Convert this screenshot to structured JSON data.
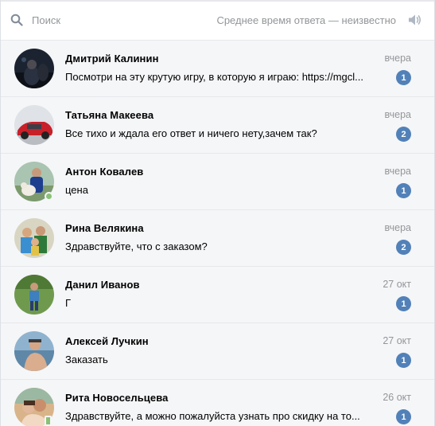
{
  "header": {
    "search_placeholder": "Поиск",
    "response_time": "Среднее время ответа — неизвестно"
  },
  "icons": {
    "search": "search-icon",
    "sound": "speaker-icon"
  },
  "colors": {
    "accent": "#5181b8",
    "online": "#8ac176",
    "muted_text": "#939699",
    "background": "#f5f6f8"
  },
  "conversations": [
    {
      "name": "Дмитрий Калинин",
      "date": "вчера",
      "message": "Посмотри на эту крутую игру, в которую я играю: https://mgcl...",
      "unread": "1",
      "status": "none"
    },
    {
      "name": "Татьяна Макеева",
      "date": "вчера",
      "message": "Все тихо и ждала его ответ и ничего нету,зачем так?",
      "unread": "2",
      "status": "none"
    },
    {
      "name": "Антон Ковалев",
      "date": "вчера",
      "message": "цена",
      "unread": "1",
      "status": "online"
    },
    {
      "name": "Рина Велякина",
      "date": "вчера",
      "message": "Здравствуйте, что с заказом?",
      "unread": "2",
      "status": "none"
    },
    {
      "name": "Данил Иванов",
      "date": "27 окт",
      "message": "Г",
      "unread": "1",
      "status": "none"
    },
    {
      "name": "Алексей Лучкин",
      "date": "27 окт",
      "message": "Заказать",
      "unread": "1",
      "status": "none"
    },
    {
      "name": "Рита Новосельцева",
      "date": "26 окт",
      "message": "Здравствуйте, а можно пожалуйста узнать про скидку на то...",
      "unread": "1",
      "status": "mobile"
    }
  ]
}
